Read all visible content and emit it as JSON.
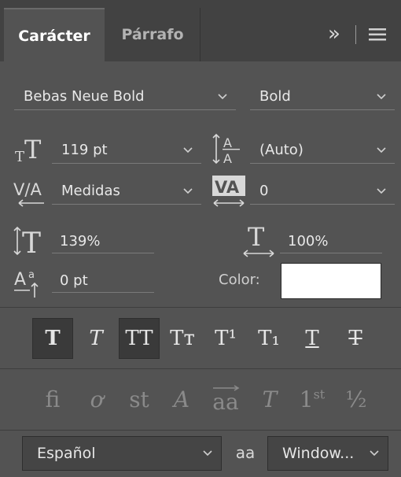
{
  "tabs": [
    {
      "label": "Carácter"
    },
    {
      "label": "Párrafo"
    }
  ],
  "panel_menu": {
    "expand_glyph": "»",
    "menu_glyph": "≡"
  },
  "font": {
    "family": "Bebas Neue Bold",
    "style": "Bold"
  },
  "size": {
    "value": "119 pt"
  },
  "leading": {
    "value": "(Auto)"
  },
  "kerning": {
    "value": "Medidas"
  },
  "tracking": {
    "value": "0"
  },
  "vertical_scale": {
    "value": "139%"
  },
  "horizontal_scale": {
    "value": "100%"
  },
  "baseline_shift": {
    "value": "0 pt"
  },
  "color": {
    "label": "Color:",
    "swatch": "#ffffff"
  },
  "style_buttons": [
    {
      "glyph": "T",
      "name": "faux-bold",
      "active": true
    },
    {
      "glyph": "T",
      "name": "faux-italic",
      "active": false
    },
    {
      "glyph": "TT",
      "name": "all-caps",
      "active": true
    },
    {
      "glyph": "Tт",
      "name": "small-caps",
      "active": false
    },
    {
      "glyph": "T¹",
      "name": "superscript",
      "active": false
    },
    {
      "glyph": "T₁",
      "name": "subscript",
      "active": false
    },
    {
      "glyph": "T",
      "name": "underline",
      "active": false
    },
    {
      "glyph": "T",
      "name": "strikethrough",
      "active": false
    }
  ],
  "opentype_buttons": [
    {
      "glyph": "fi",
      "name": "ligatures"
    },
    {
      "glyph": "ơ",
      "name": "discretionary-ligatures"
    },
    {
      "glyph": "st",
      "name": "historical-ligatures"
    },
    {
      "glyph": "A",
      "name": "swash"
    },
    {
      "glyph": "aa",
      "name": "stylistic-alternates"
    },
    {
      "glyph": "T",
      "name": "titling-alternates"
    },
    {
      "glyph": "1st",
      "name": "ordinals"
    },
    {
      "glyph": "½",
      "name": "fractions"
    }
  ],
  "language": {
    "value": "Español"
  },
  "antialias": {
    "icon_label": "aa",
    "value": "Window..."
  },
  "colors": {
    "panel": "#535353",
    "tabbar": "#424242",
    "active_button": "#3a3a3a"
  }
}
